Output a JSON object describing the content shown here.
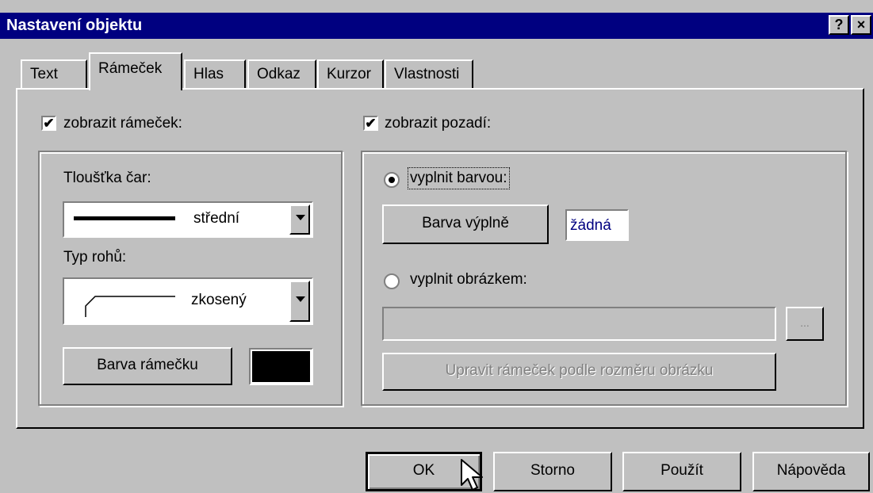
{
  "window": {
    "title": "Nastavení objektu",
    "help_button": "?",
    "close_button": "×"
  },
  "tabs": [
    {
      "label": "Text"
    },
    {
      "label": "Rámeček",
      "active": true
    },
    {
      "label": "Hlas"
    },
    {
      "label": "Odkaz"
    },
    {
      "label": "Kurzor"
    },
    {
      "label": "Vlastnosti"
    }
  ],
  "frame": {
    "show_frame_label": "zobrazit rámeček:",
    "show_frame_checked": true,
    "line_thickness_label": "Tloušťka čar:",
    "line_thickness_value": "střední",
    "corner_type_label": "Typ rohů:",
    "corner_type_value": "zkosený",
    "frame_color_button": "Barva rámečku",
    "frame_color": "#000000"
  },
  "background": {
    "show_background_label": "zobrazit pozadí:",
    "show_background_checked": true,
    "fill_color_label": "vyplnit barvou:",
    "fill_color_selected": true,
    "fill_color_button": "Barva výplně",
    "fill_color_value": "žádná",
    "fill_image_label": "vyplnit obrázkem:",
    "fill_image_selected": false,
    "image_path_value": "",
    "browse_button": "...",
    "resize_button": "Upravit rámeček podle rozměru obrázku"
  },
  "footer": {
    "ok": "OK",
    "cancel": "Storno",
    "apply": "Použít",
    "help": "Nápověda"
  }
}
